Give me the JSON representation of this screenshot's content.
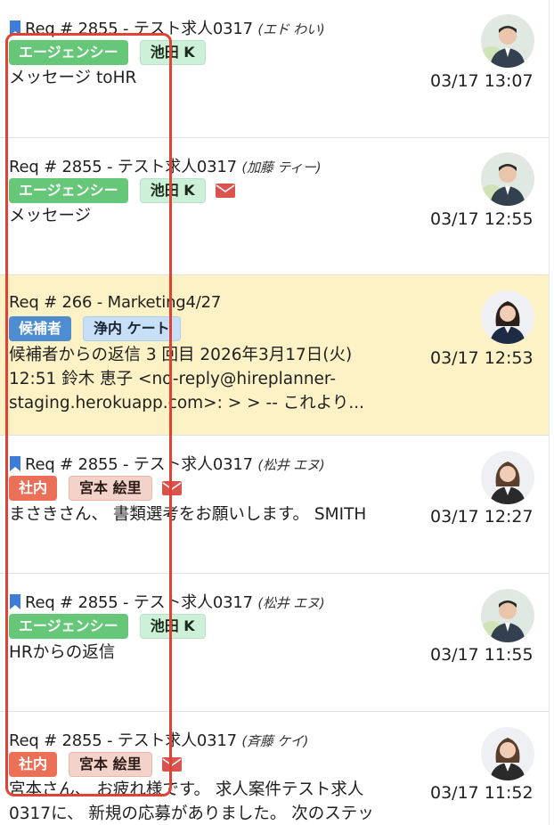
{
  "items": [
    {
      "bookmarked": true,
      "title": "Req # 2855 - テスト求人0317",
      "candidate": "(エド わい)",
      "tag": "エージェンシー",
      "person": "池田 K",
      "mail": false,
      "message": "メッセージ toHR",
      "time": "03/17 13:07",
      "avatar": "man-avatar-icon"
    },
    {
      "bookmarked": false,
      "title": "Req # 2855 - テスト求人0317",
      "candidate": "(加藤 ティー)",
      "tag": "エージェンシー",
      "person": "池田 K",
      "mail": true,
      "message": "メッセージ",
      "time": "03/17 12:55",
      "avatar": "man-avatar-icon"
    },
    {
      "bookmarked": false,
      "title": "Req # 266 - Marketing4/27",
      "candidate": "",
      "tag": "候補者",
      "person": "浄内 ケート",
      "mail": false,
      "message": "候補者からの返信 3 回目 2026年3月17日(火)\n12:51 鈴木 恵子 <no-reply@hireplanner-\nstaging.herokuapp.com>: > > -- これより...",
      "time": "03/17 12:53",
      "avatar": "woman-avatar-icon"
    },
    {
      "bookmarked": true,
      "title": "Req # 2855 - テスト求人0317",
      "candidate": "(松井 エヌ)",
      "tag": "社内",
      "person": "宮本 絵里",
      "mail": true,
      "message": "まさきさん、 書類選考をお願いします。 SMITH",
      "time": "03/17 12:27",
      "avatar": "woman-avatar-icon"
    },
    {
      "bookmarked": true,
      "title": "Req # 2855 - テスト求人0317",
      "candidate": "(松井 エヌ)",
      "tag": "エージェンシー",
      "person": "池田 K",
      "mail": false,
      "message": "HRからの返信",
      "time": "03/17 11:55",
      "avatar": "man-avatar-icon"
    },
    {
      "bookmarked": false,
      "title": "Req # 2855 - テスト求人0317",
      "candidate": "(斉藤 ケイ)",
      "tag": "社内",
      "person": "宮本 絵里",
      "mail": true,
      "message": "宮本さん、 お疲れ様です。 求人案件テスト求人\n0317に、 新規の応募がありました。 次のステッ",
      "time": "03/17 11:52",
      "avatar": "woman-avatar-icon"
    }
  ],
  "colors": {
    "agency": "#66c778",
    "candidate": "#4f8dd1",
    "internal": "#ec6f57",
    "highlight_row": "#fcf2c6",
    "annotation_box": "#e14233",
    "bookmark": "#3b7dd8",
    "mail": "#d9534f"
  }
}
